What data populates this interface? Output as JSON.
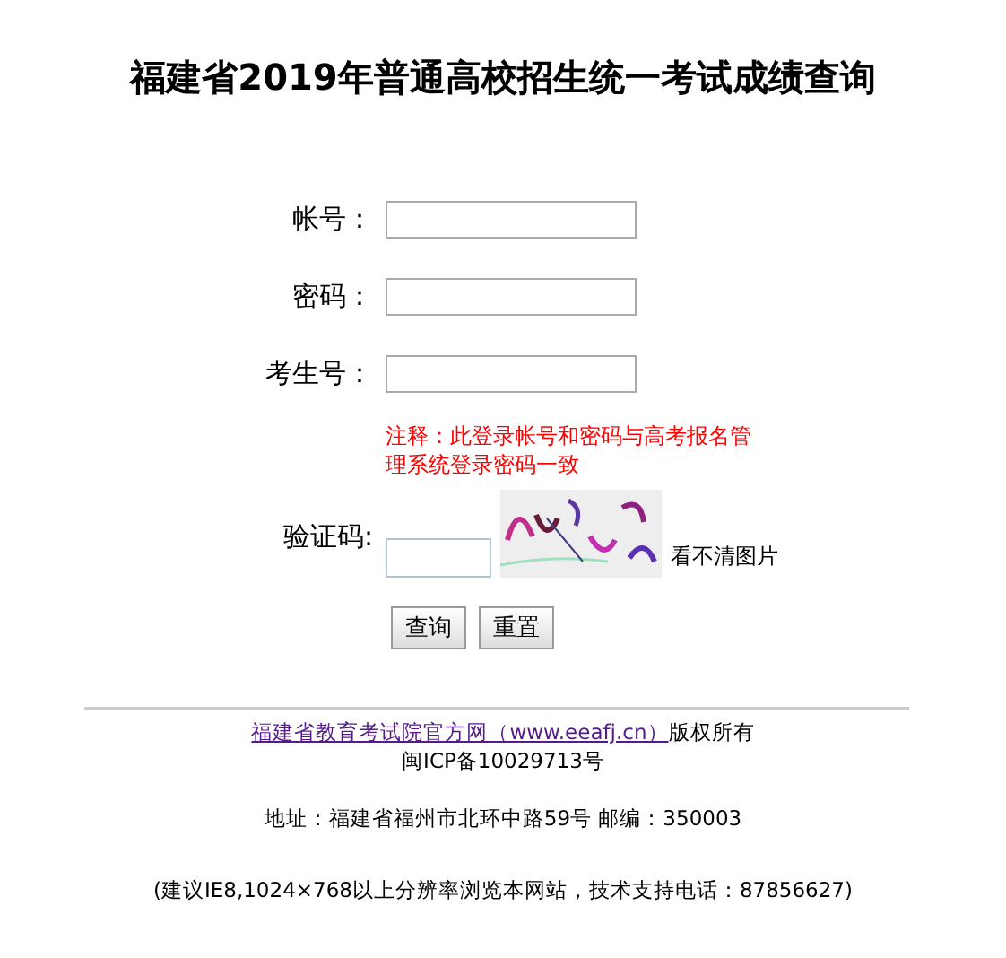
{
  "title": "福建省2019年普通高校招生统一考试成绩查询",
  "fields": [
    {
      "label": "帐号："
    },
    {
      "label": "密码："
    },
    {
      "label": "考生号："
    }
  ],
  "note": "注释：此登录帐号和密码与高考报名管理系统登录密码一致",
  "captcha": {
    "label": "验证码:",
    "refresh_link": "看不清图片"
  },
  "buttons": [
    "查询",
    "重置"
  ],
  "footer": {
    "link": "福建省教育考试院官方网（www.eeafj.cn）",
    "copyright": "版权所有",
    "icp": "闽ICP备10029713号",
    "address": "地址：福建省福州市北环中路59号 邮编：350003",
    "support": "(建议IE8,1024×768以上分辨率浏览本网站，技术支持电话：87856627)"
  }
}
